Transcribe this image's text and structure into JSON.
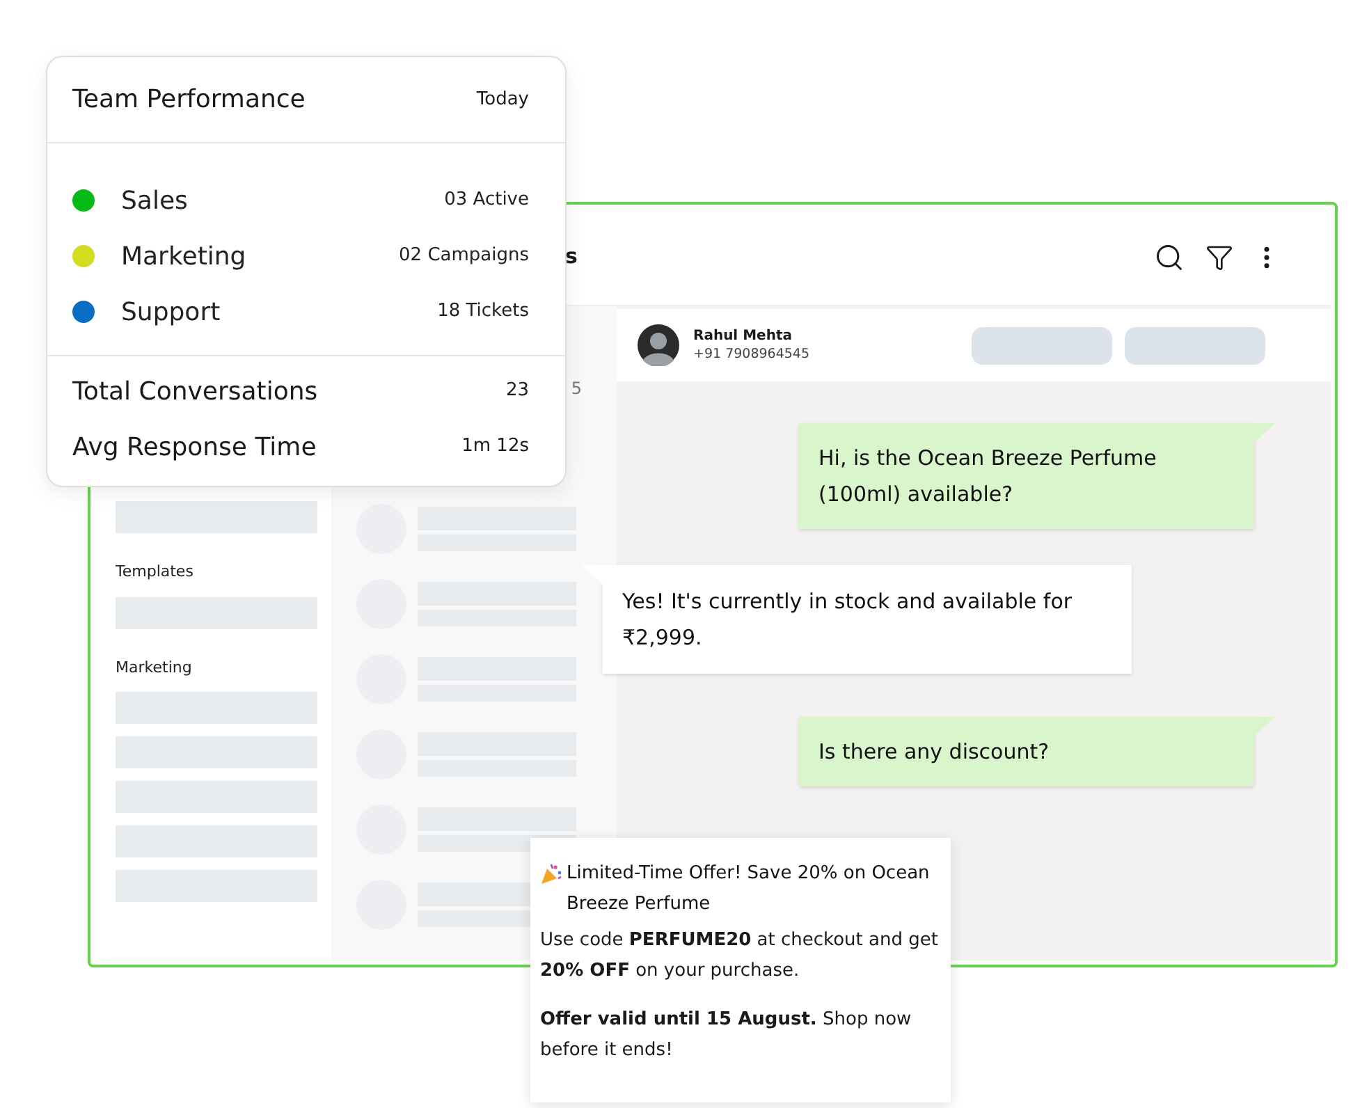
{
  "team_performance": {
    "title": "Team Performance",
    "period": "Today",
    "teams": [
      {
        "name": "Sales",
        "count": "03 Active",
        "color": "#08bb14"
      },
      {
        "name": "Marketing",
        "count": "02 Campaigns",
        "color": "#d4dc1e"
      },
      {
        "name": "Support",
        "count": "18 Tickets",
        "color": "#0a6fc2"
      }
    ],
    "stats": [
      {
        "label": "Total Conversations",
        "value": "23"
      },
      {
        "label": "Avg Response Time",
        "value": "1m 12s"
      }
    ]
  },
  "inbox": {
    "header_title": "s",
    "sidebar": [
      {
        "kind": "placeholder"
      },
      {
        "kind": "label",
        "text": "Templates"
      },
      {
        "kind": "placeholder"
      },
      {
        "kind": "label",
        "text": "Marketing"
      },
      {
        "kind": "placeholder"
      },
      {
        "kind": "placeholder"
      },
      {
        "kind": "placeholder"
      },
      {
        "kind": "placeholder"
      },
      {
        "kind": "placeholder"
      }
    ],
    "conversation_list": {
      "visible_fragment": "5"
    },
    "contact": {
      "name": "Rahul Mehta",
      "phone": "+91 7908964545"
    },
    "messages": [
      {
        "kind": "out",
        "text": "Hi, is the Ocean Breeze Perfume (100ml) available?"
      },
      {
        "kind": "in",
        "text": "Yes! It's currently in stock and available for ₹2,999."
      },
      {
        "kind": "out",
        "text": "Is there any discount?"
      }
    ]
  },
  "promo": {
    "title": "Limited-Time Offer! Save 20% on Ocean Breeze Perfume",
    "body": [
      "Use code **PERFUME20** at checkout and get **20% OFF** on your purchase.",
      "**Offer valid until 15 August.** Shop now before it ends!"
    ]
  }
}
